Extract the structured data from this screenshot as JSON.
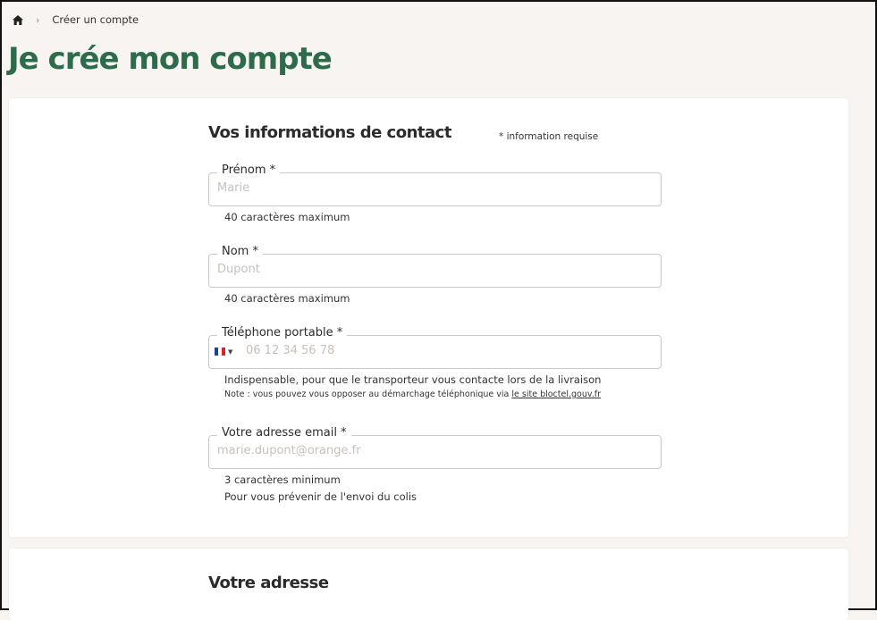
{
  "breadcrumb": {
    "home_icon": "home-icon",
    "separator_icon": "chevron-right-icon",
    "current": "Créer un compte"
  },
  "page": {
    "title": "Je crée mon compte"
  },
  "contact_section": {
    "title": "Vos informations de contact",
    "required_note": "* information requise",
    "fields": {
      "firstname": {
        "label": "Prénom *",
        "placeholder": "Marie",
        "value": "",
        "hint": "40 caractères maximum"
      },
      "lastname": {
        "label": "Nom *",
        "placeholder": "Dupont",
        "value": "",
        "hint": "40 caractères maximum"
      },
      "phone": {
        "label": "Téléphone portable *",
        "placeholder": "06 12 34 56 78",
        "value": "",
        "country_flag_icon": "france-flag-icon",
        "dropdown_icon": "caret-down-icon",
        "hint": "Indispensable, pour que le transporteur vous contacte lors de la livraison",
        "note_prefix": "Note : vous pouvez vous opposer au démarchage téléphonique via ",
        "note_link": "le site bloctel.gouv.fr"
      },
      "email": {
        "label": "Votre adresse email *",
        "placeholder": "marie.dupont@orange.fr",
        "value": "",
        "hint": "3 caractères minimum",
        "hint2": "Pour vous prévenir de l'envoi du colis"
      }
    }
  },
  "address_section": {
    "title": "Votre adresse"
  },
  "colors": {
    "accent_green": "#2e6b4a",
    "page_background": "#f7f4f1",
    "card_background": "#ffffff",
    "field_border": "#c9c9c9",
    "placeholder": "#c7c0bb"
  }
}
